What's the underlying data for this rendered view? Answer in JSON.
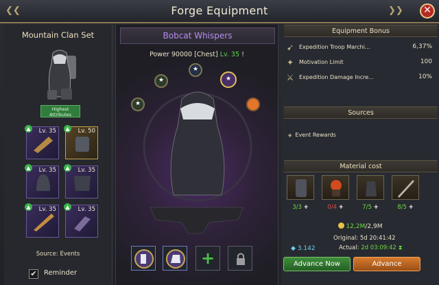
{
  "header": {
    "title": "Forge Equipment"
  },
  "left": {
    "set_title": "Mountain Clan Set",
    "highest_attributes_label": "Highest\nAttributes",
    "slots": [
      {
        "level": "Lv. 35"
      },
      {
        "level": "Lv. 50"
      },
      {
        "level": "Lv. 35"
      },
      {
        "level": "Lv. 35"
      },
      {
        "level": "Lv. 35"
      },
      {
        "level": "Lv. 35"
      }
    ],
    "source_text": "Source: Events",
    "reminder_label": "Reminder",
    "reminder_checked": "✔"
  },
  "center": {
    "item_name": "Bobcat Whispers",
    "power_text": "Power 90000 [Chest]",
    "level_text": "Lv. 35",
    "warning_icon": "!"
  },
  "right": {
    "equipment_bonus_title": "Equipment Bonus",
    "bonuses": [
      {
        "name": "Expedition Troop Marchi...",
        "value": "6,37%",
        "icon": "troop-march-icon"
      },
      {
        "name": "Motivation Limit",
        "value": "100",
        "icon": "motivation-icon"
      },
      {
        "name": "Expedition Damage Incre...",
        "value": "10%",
        "icon": "damage-icon"
      }
    ],
    "sources_title": "Sources",
    "source_item": "Event Rewards",
    "material_cost_title": "Material cost",
    "materials": [
      {
        "have": "3",
        "need": "/3",
        "ok": true
      },
      {
        "have": "0",
        "need": "/4",
        "ok": false
      },
      {
        "have": "7",
        "need": "/5",
        "ok": true
      },
      {
        "have": "8",
        "need": "/5",
        "ok": true
      }
    ],
    "money_have": "12,2M",
    "money_need": "/2,9M",
    "original_label": "Original:",
    "original_time": "5d 20:41:42",
    "actual_label": "Actual:",
    "actual_time": "2d 03:09:42",
    "speedup_value": "3.142",
    "advance_now_label": "Advance Now",
    "advance_label": "Advance"
  },
  "colors": {
    "accent_purple": "#b58ef0",
    "green": "#6ddb45",
    "red": "#e74a3d",
    "close_red": "#b42b24"
  }
}
